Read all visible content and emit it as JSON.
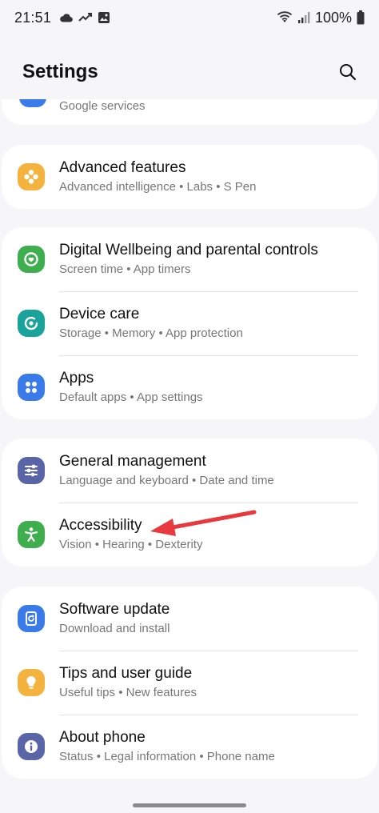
{
  "status_bar": {
    "time": "21:51",
    "battery": "100%",
    "left_icons": [
      "cloud-icon",
      "trend-icon",
      "image-icon"
    ],
    "right_icons": [
      "wifi-icon",
      "signal-icon",
      "battery-icon"
    ]
  },
  "header": {
    "title": "Settings",
    "search_icon": "search-icon"
  },
  "partial_item": {
    "subtitle": "Google services"
  },
  "groups": [
    {
      "items": [
        {
          "title": "Advanced features",
          "subtitle": "Advanced intelligence  •  Labs  •  S Pen",
          "icon": "advanced-features-icon",
          "color": "#f4b23e"
        }
      ]
    },
    {
      "items": [
        {
          "title": "Digital Wellbeing and parental controls",
          "subtitle": "Screen time  •  App timers",
          "icon": "wellbeing-icon",
          "color": "#3fae4f"
        },
        {
          "title": "Device care",
          "subtitle": "Storage  •  Memory  •  App protection",
          "icon": "device-care-icon",
          "color": "#1aa39a"
        },
        {
          "title": "Apps",
          "subtitle": "Default apps  •  App settings",
          "icon": "apps-icon",
          "color": "#3b7be9"
        }
      ]
    },
    {
      "items": [
        {
          "title": "General management",
          "subtitle": "Language and keyboard  •  Date and time",
          "icon": "general-management-icon",
          "color": "#5a65a8"
        },
        {
          "title": "Accessibility",
          "subtitle": "Vision  •  Hearing  •  Dexterity",
          "icon": "accessibility-icon",
          "color": "#3fae4f"
        }
      ]
    },
    {
      "items": [
        {
          "title": "Software update",
          "subtitle": "Download and install",
          "icon": "software-update-icon",
          "color": "#3b7be9"
        },
        {
          "title": "Tips and user guide",
          "subtitle": "Useful tips  •  New features",
          "icon": "tips-icon",
          "color": "#f4b23e"
        },
        {
          "title": "About phone",
          "subtitle": "Status  •  Legal information  •  Phone name",
          "icon": "about-phone-icon",
          "color": "#5a65a8"
        }
      ]
    }
  ],
  "annotation": {
    "arrow_color": "#e8393f",
    "points_to": "Accessibility"
  }
}
